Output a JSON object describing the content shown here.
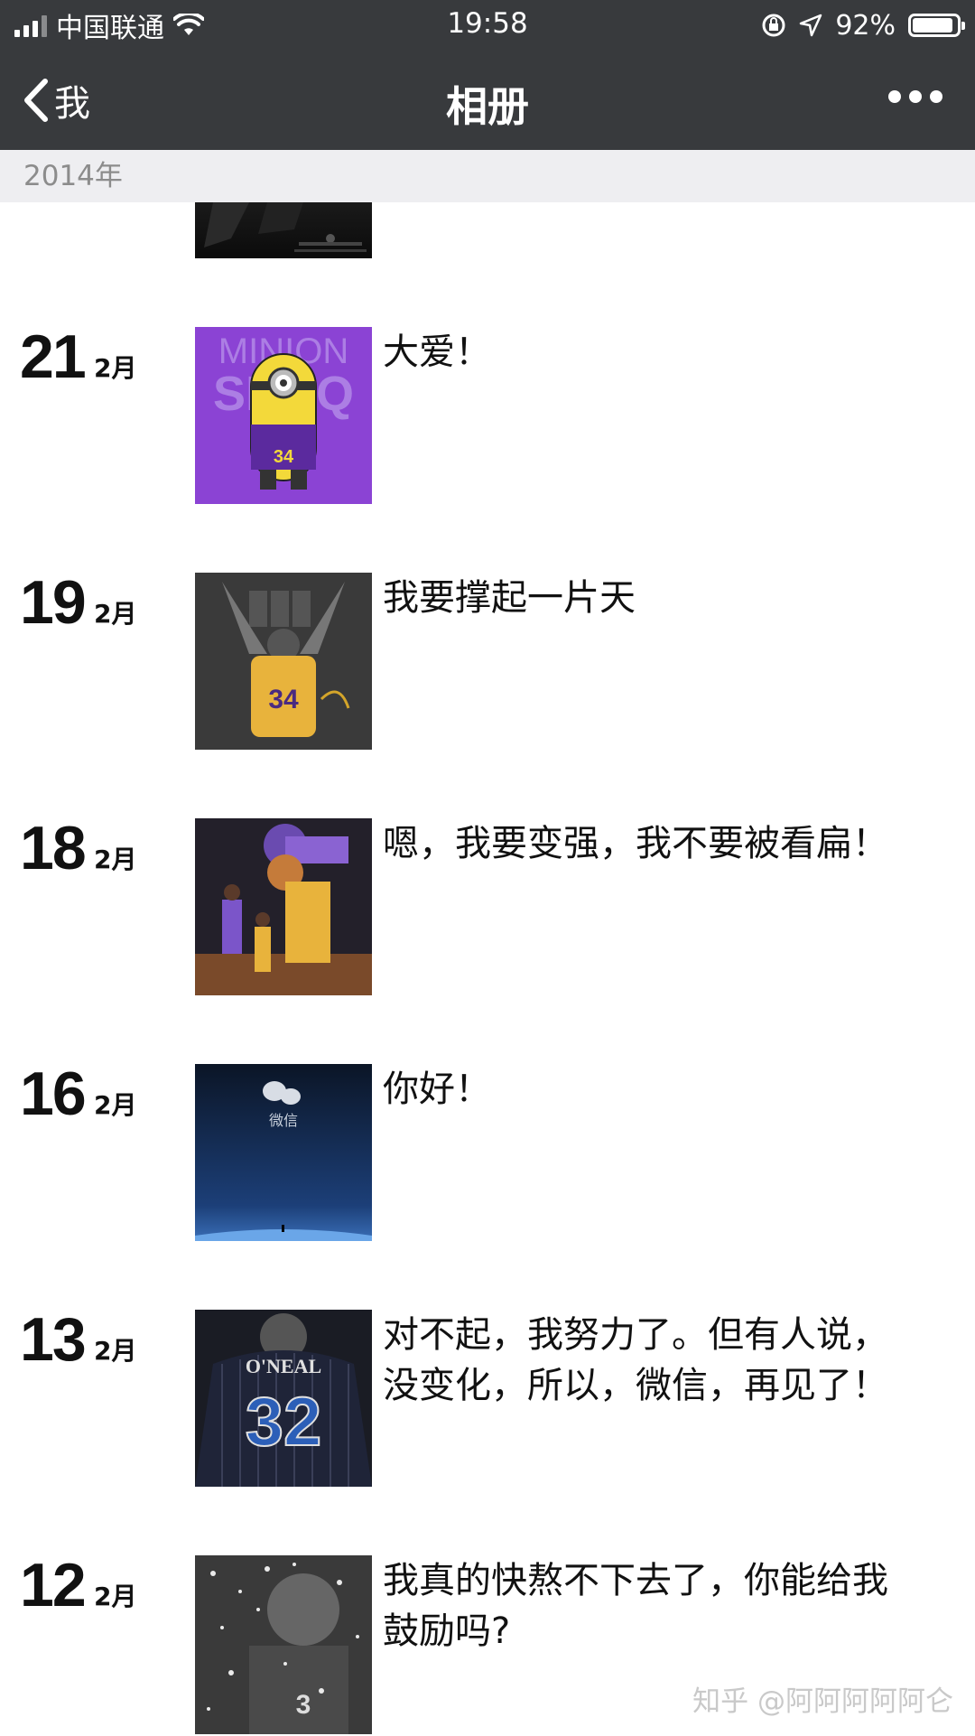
{
  "status_bar": {
    "carrier": "中国联通",
    "time": "19:58",
    "battery": "92%",
    "battery_level": 0.92
  },
  "nav": {
    "back_label": "我",
    "title": "相册"
  },
  "year_header": "2014年",
  "entries": [
    {
      "day": "21",
      "month": "2月",
      "caption": "大爱！",
      "thumb_text_top": "MINION",
      "thumb_text_bottom": "SHAQ",
      "thumb_jersey": "34"
    },
    {
      "day": "19",
      "month": "2月",
      "caption": "我要撑起一片天",
      "thumb_jersey": "34"
    },
    {
      "day": "18",
      "month": "2月",
      "caption": "嗯，我要变强，我不要被看扁！"
    },
    {
      "day": "16",
      "month": "2月",
      "caption": "你好！",
      "thumb_label": "微信"
    },
    {
      "day": "13",
      "month": "2月",
      "caption": "对不起，我努力了。但有人说，没变化，所以，微信，再见了！",
      "thumb_name": "O'NEAL",
      "thumb_jersey": "32"
    },
    {
      "day": "12",
      "month": "2月",
      "caption": "我真的快熬不下去了，你能给我鼓励吗?"
    }
  ],
  "watermark": "知乎 @阿阿阿阿阿仑",
  "colors": {
    "bar_bg": "#383a3d",
    "year_bar_bg": "#eeeef1"
  }
}
